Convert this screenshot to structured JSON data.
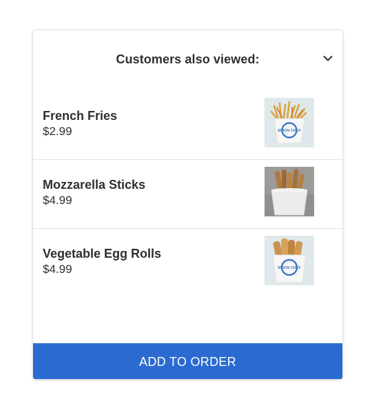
{
  "header": {
    "title": "Customers also viewed:",
    "toggle_icon": "chevron-down-icon"
  },
  "items": [
    {
      "name": "French Fries",
      "price": "$2.99",
      "image": "french-fries-cup-image",
      "cup_label": "MOON CHEF"
    },
    {
      "name": "Mozzarella Sticks",
      "price": "$4.99",
      "image": "mozzarella-sticks-cup-image"
    },
    {
      "name": "Vegetable Egg Rolls",
      "price": "$4.99",
      "image": "egg-rolls-cup-image",
      "cup_label": "MOON CHEF"
    }
  ],
  "cta": {
    "label": "ADD TO ORDER"
  },
  "colors": {
    "accent": "#2b6bd1",
    "text": "#2f2f2f",
    "divider": "#e3e3e3"
  }
}
